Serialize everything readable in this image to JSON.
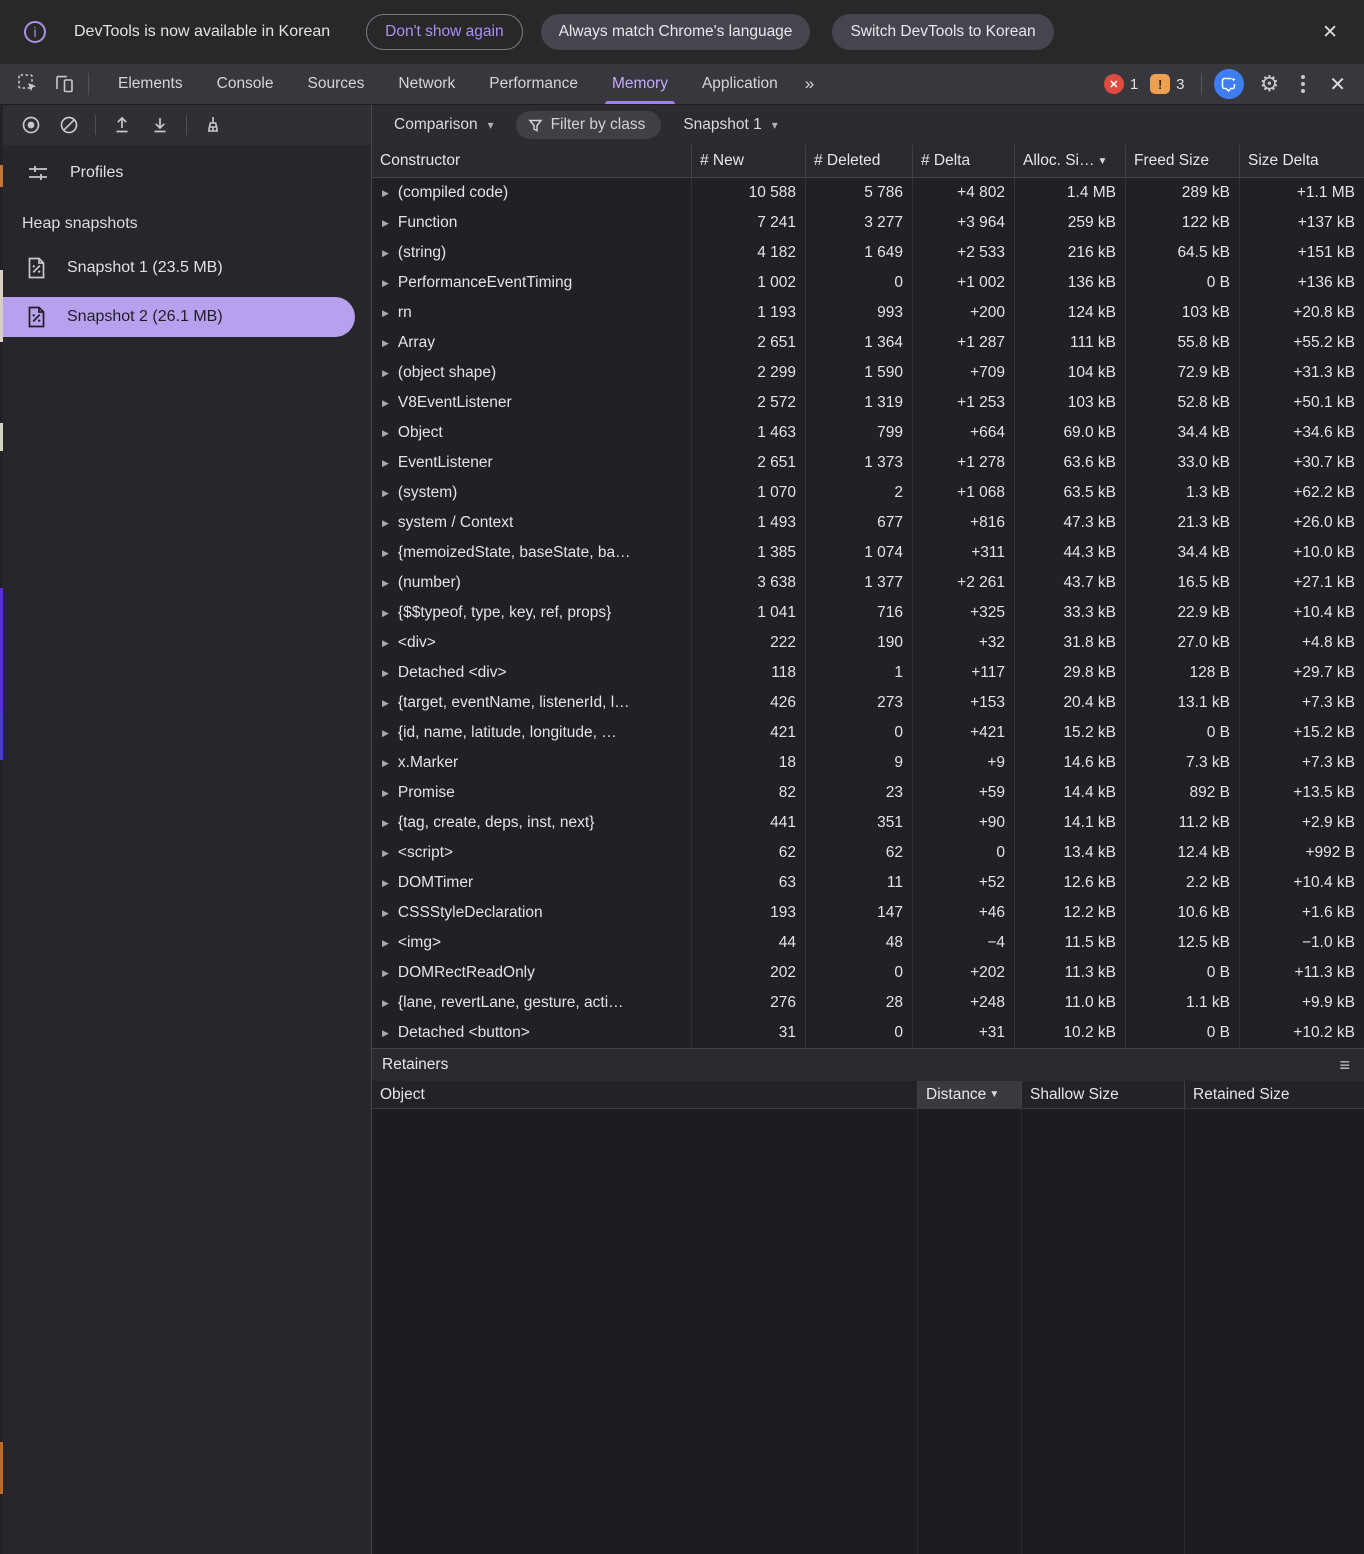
{
  "infobar": {
    "message": "DevTools is now available in Korean",
    "dismiss_label": "Don't show again",
    "match_label": "Always match Chrome's language",
    "switch_label": "Switch DevTools to Korean",
    "close_glyph": "✕",
    "accent_color": "#ac8ef6"
  },
  "tabbar": {
    "tabs": [
      "Elements",
      "Console",
      "Sources",
      "Network",
      "Performance",
      "Memory",
      "Application"
    ],
    "selected_tab": "Memory",
    "overflow_glyph": "»",
    "error_count": "1",
    "issue_count": "3",
    "selected_color": "#c5a9f9"
  },
  "sidebar": {
    "profiles_label": "Profiles",
    "heap_section_label": "Heap snapshots",
    "snapshots": [
      {
        "label": "Snapshot 1 (23.5 MB)"
      },
      {
        "label": "Snapshot 2 (26.1 MB)"
      }
    ],
    "selected_index": 1,
    "selection_color": "#b7a0ee"
  },
  "main": {
    "toolbar": {
      "view_mode": "Comparison",
      "filter_label": "Filter by class",
      "baseline": "Snapshot 1"
    },
    "table": {
      "columns": [
        "Constructor",
        "# New",
        "# Deleted",
        "# Delta",
        "Alloc. Si…",
        "Freed Size",
        "Size Delta"
      ],
      "sorted_column": "Alloc. Si…",
      "sort_glyph": "▼",
      "rows": [
        {
          "name": "(compiled code)",
          "new": "10 588",
          "deleted": "5 786",
          "delta": "+4 802",
          "alloc": "1.4 MB",
          "freed": "289 kB",
          "size": "+1.1 MB"
        },
        {
          "name": "Function",
          "new": "7 241",
          "deleted": "3 277",
          "delta": "+3 964",
          "alloc": "259 kB",
          "freed": "122 kB",
          "size": "+137 kB"
        },
        {
          "name": "(string)",
          "new": "4 182",
          "deleted": "1 649",
          "delta": "+2 533",
          "alloc": "216 kB",
          "freed": "64.5 kB",
          "size": "+151 kB"
        },
        {
          "name": "PerformanceEventTiming",
          "new": "1 002",
          "deleted": "0",
          "delta": "+1 002",
          "alloc": "136 kB",
          "freed": "0 B",
          "size": "+136 kB"
        },
        {
          "name": "rn",
          "new": "1 193",
          "deleted": "993",
          "delta": "+200",
          "alloc": "124 kB",
          "freed": "103 kB",
          "size": "+20.8 kB"
        },
        {
          "name": "Array",
          "new": "2 651",
          "deleted": "1 364",
          "delta": "+1 287",
          "alloc": "111 kB",
          "freed": "55.8 kB",
          "size": "+55.2 kB"
        },
        {
          "name": "(object shape)",
          "new": "2 299",
          "deleted": "1 590",
          "delta": "+709",
          "alloc": "104 kB",
          "freed": "72.9 kB",
          "size": "+31.3 kB"
        },
        {
          "name": "V8EventListener",
          "new": "2 572",
          "deleted": "1 319",
          "delta": "+1 253",
          "alloc": "103 kB",
          "freed": "52.8 kB",
          "size": "+50.1 kB"
        },
        {
          "name": "Object",
          "new": "1 463",
          "deleted": "799",
          "delta": "+664",
          "alloc": "69.0 kB",
          "freed": "34.4 kB",
          "size": "+34.6 kB"
        },
        {
          "name": "EventListener",
          "new": "2 651",
          "deleted": "1 373",
          "delta": "+1 278",
          "alloc": "63.6 kB",
          "freed": "33.0 kB",
          "size": "+30.7 kB"
        },
        {
          "name": "(system)",
          "new": "1 070",
          "deleted": "2",
          "delta": "+1 068",
          "alloc": "63.5 kB",
          "freed": "1.3 kB",
          "size": "+62.2 kB"
        },
        {
          "name": "system / Context",
          "new": "1 493",
          "deleted": "677",
          "delta": "+816",
          "alloc": "47.3 kB",
          "freed": "21.3 kB",
          "size": "+26.0 kB"
        },
        {
          "name": "{memoizedState, baseState, ba…",
          "new": "1 385",
          "deleted": "1 074",
          "delta": "+311",
          "alloc": "44.3 kB",
          "freed": "34.4 kB",
          "size": "+10.0 kB"
        },
        {
          "name": "(number)",
          "new": "3 638",
          "deleted": "1 377",
          "delta": "+2 261",
          "alloc": "43.7 kB",
          "freed": "16.5 kB",
          "size": "+27.1 kB"
        },
        {
          "name": "{$$typeof, type, key, ref, props}",
          "new": "1 041",
          "deleted": "716",
          "delta": "+325",
          "alloc": "33.3 kB",
          "freed": "22.9 kB",
          "size": "+10.4 kB"
        },
        {
          "name": "<div>",
          "new": "222",
          "deleted": "190",
          "delta": "+32",
          "alloc": "31.8 kB",
          "freed": "27.0 kB",
          "size": "+4.8 kB"
        },
        {
          "name": "Detached <div>",
          "new": "118",
          "deleted": "1",
          "delta": "+117",
          "alloc": "29.8 kB",
          "freed": "128 B",
          "size": "+29.7 kB"
        },
        {
          "name": "{target, eventName, listenerId, l…",
          "new": "426",
          "deleted": "273",
          "delta": "+153",
          "alloc": "20.4 kB",
          "freed": "13.1 kB",
          "size": "+7.3 kB"
        },
        {
          "name": "{id, name, latitude, longitude, …",
          "new": "421",
          "deleted": "0",
          "delta": "+421",
          "alloc": "15.2 kB",
          "freed": "0 B",
          "size": "+15.2 kB"
        },
        {
          "name": "x.Marker",
          "new": "18",
          "deleted": "9",
          "delta": "+9",
          "alloc": "14.6 kB",
          "freed": "7.3 kB",
          "size": "+7.3 kB"
        },
        {
          "name": "Promise",
          "new": "82",
          "deleted": "23",
          "delta": "+59",
          "alloc": "14.4 kB",
          "freed": "892 B",
          "size": "+13.5 kB"
        },
        {
          "name": "{tag, create, deps, inst, next}",
          "new": "441",
          "deleted": "351",
          "delta": "+90",
          "alloc": "14.1 kB",
          "freed": "11.2 kB",
          "size": "+2.9 kB"
        },
        {
          "name": "<script>",
          "new": "62",
          "deleted": "62",
          "delta": "0",
          "alloc": "13.4 kB",
          "freed": "12.4 kB",
          "size": "+992 B"
        },
        {
          "name": "DOMTimer",
          "new": "63",
          "deleted": "11",
          "delta": "+52",
          "alloc": "12.6 kB",
          "freed": "2.2 kB",
          "size": "+10.4 kB"
        },
        {
          "name": "CSSStyleDeclaration",
          "new": "193",
          "deleted": "147",
          "delta": "+46",
          "alloc": "12.2 kB",
          "freed": "10.6 kB",
          "size": "+1.6 kB"
        },
        {
          "name": "<img>",
          "new": "44",
          "deleted": "48",
          "delta": "−4",
          "alloc": "11.5 kB",
          "freed": "12.5 kB",
          "size": "−1.0 kB"
        },
        {
          "name": "DOMRectReadOnly",
          "new": "202",
          "deleted": "0",
          "delta": "+202",
          "alloc": "11.3 kB",
          "freed": "0 B",
          "size": "+11.3 kB"
        },
        {
          "name": "{lane, revertLane, gesture, acti…",
          "new": "276",
          "deleted": "28",
          "delta": "+248",
          "alloc": "11.0 kB",
          "freed": "1.1 kB",
          "size": "+9.9 kB"
        },
        {
          "name": "Detached <button>",
          "new": "31",
          "deleted": "0",
          "delta": "+31",
          "alloc": "10.2 kB",
          "freed": "0 B",
          "size": "+10.2 kB"
        }
      ]
    },
    "retainers": {
      "title": "Retainers",
      "columns": [
        "Object",
        "Distance",
        "Shallow Size",
        "Retained Size"
      ],
      "sorted_column": "Distance",
      "sort_glyph": "▼"
    }
  }
}
